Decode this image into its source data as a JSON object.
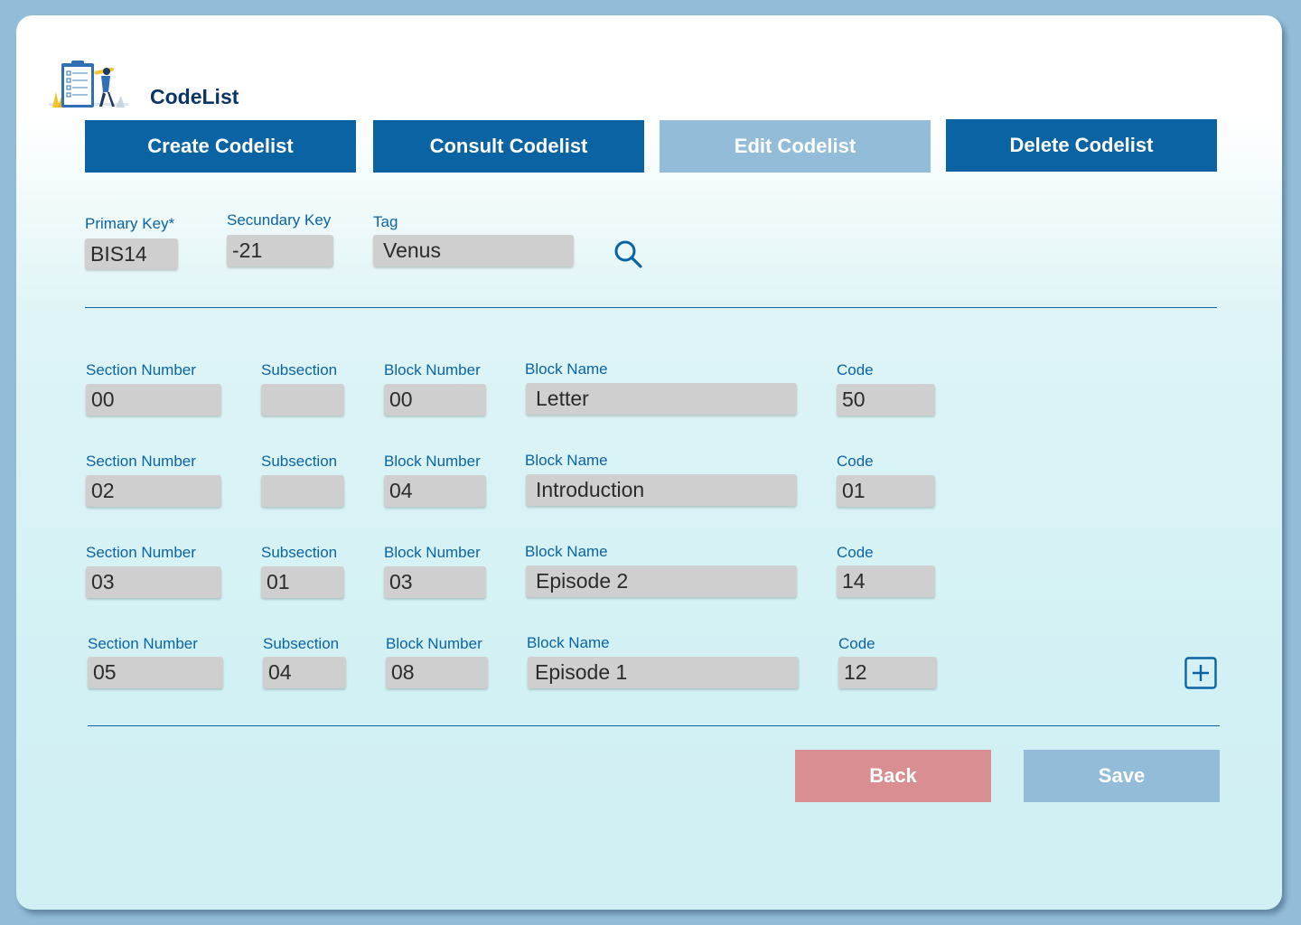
{
  "app": {
    "title": "CodeList"
  },
  "actions": {
    "create": "Create Codelist",
    "consult": "Consult Codelist",
    "edit": "Edit Codelist",
    "delete": "Delete Codelist"
  },
  "search": {
    "primary_key_label": "Primary Key*",
    "primary_key_value": "BIS14",
    "secondary_key_label": "Secundary Key",
    "secondary_key_value": "-21",
    "tag_label": "Tag",
    "tag_value": "Venus"
  },
  "row_labels": {
    "section_number": "Section Number",
    "subsection": "Subsection",
    "block_number": "Block Number",
    "block_name": "Block Name",
    "code": "Code"
  },
  "rows": [
    {
      "section_number": "00",
      "subsection": "",
      "block_number": "00",
      "block_name": "Letter",
      "code": "50"
    },
    {
      "section_number": "02",
      "subsection": "",
      "block_number": "04",
      "block_name": "Introduction",
      "code": "01"
    },
    {
      "section_number": "03",
      "subsection": "01",
      "block_number": "03",
      "block_name": "Episode 2",
      "code": "14"
    },
    {
      "section_number": "05",
      "subsection": "04",
      "block_number": "08",
      "block_name": "Episode 1",
      "code": "12"
    }
  ],
  "footer": {
    "back": "Back",
    "save": "Save"
  },
  "colors": {
    "primary": "#0a64a4",
    "disabled": "#93bcd8",
    "back": "#d98f91",
    "title": "#0b3566",
    "field": "#cfcfcf"
  }
}
